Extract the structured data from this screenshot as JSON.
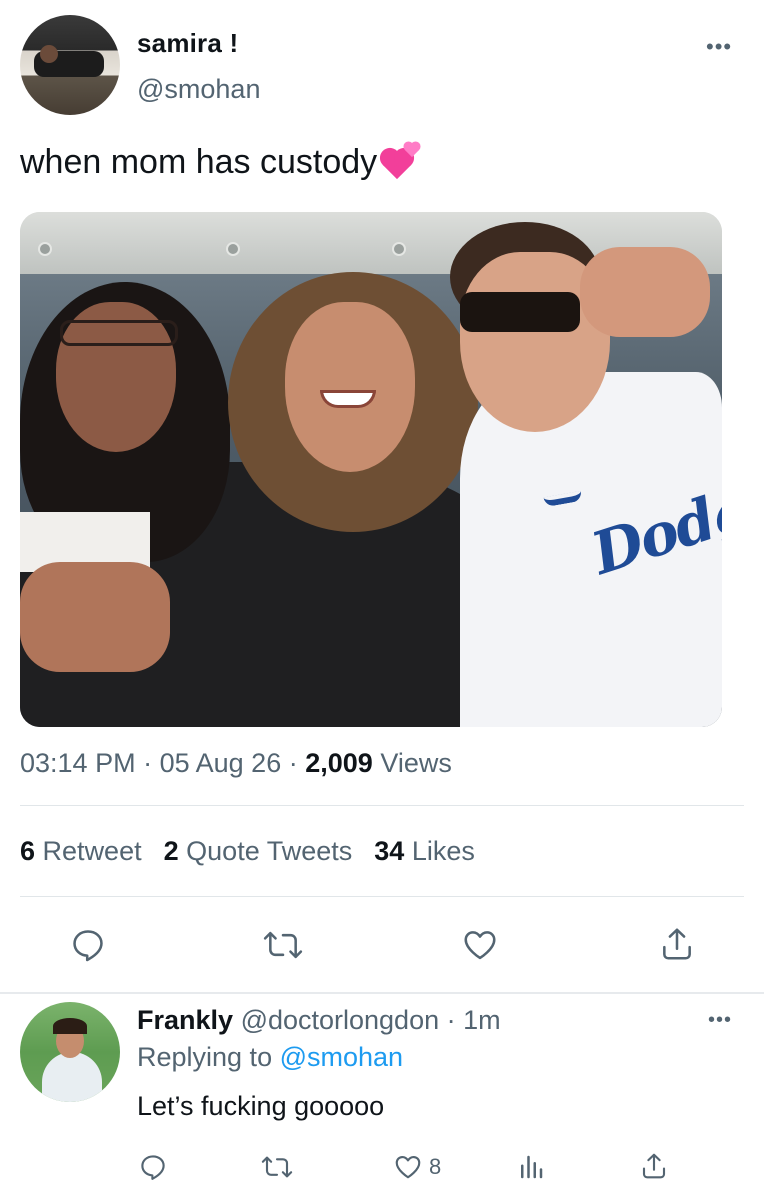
{
  "tweet": {
    "display_name": "samira !",
    "handle": "@smohan",
    "more_icon": "more-horizontal-icon",
    "text": "when mom has custody",
    "emoji": "two-hearts-emoji",
    "time": "03:14 PM",
    "date": "05 Aug 26",
    "views_count": "2,009",
    "views_label": "Views",
    "retweets_count": "6",
    "retweets_label": "Retweet",
    "quotes_count": "2",
    "quotes_label": "Quote Tweets",
    "likes_count": "34",
    "likes_label": "Likes",
    "actions": [
      "reply-icon",
      "retweet-icon",
      "like-icon",
      "share-icon"
    ]
  },
  "reply": {
    "display_name": "Frankly",
    "handle": "@doctorlongdon",
    "time": "1m",
    "replying_prefix": "Replying to",
    "replying_to": "@smohan",
    "text": "Let’s fucking gooooo",
    "like_count": "8",
    "actions": [
      "reply-icon",
      "retweet-icon",
      "like-icon",
      "analytics-icon",
      "share-icon"
    ]
  },
  "colors": {
    "text": "#0f1419",
    "secondary": "#536471",
    "link": "#1d9bf0",
    "divider": "#e1e6e9"
  }
}
